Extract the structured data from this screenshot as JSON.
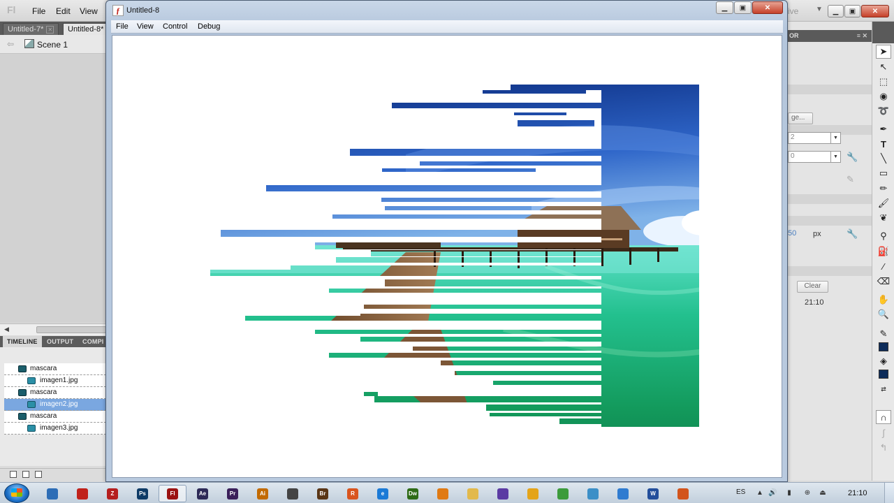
{
  "ide": {
    "logo": "Fl",
    "menus": [
      "File",
      "Edit",
      "View"
    ],
    "right_text": "ive",
    "doc_tabs": [
      "Untitled-7*",
      "Untitled-8*"
    ],
    "scene_label": "Scene 1",
    "panel_tabs": [
      "TIMELINE",
      "OUTPUT",
      "COMPI"
    ],
    "layers": [
      {
        "name": "mascara",
        "type": "mask"
      },
      {
        "name": "imagen1.jpg",
        "type": "masked"
      },
      {
        "name": "mascara",
        "type": "mask"
      },
      {
        "name": "imagen2.jpg",
        "type": "masked",
        "selected": true
      },
      {
        "name": "mascara",
        "type": "mask"
      },
      {
        "name": "imagen3.jpg",
        "type": "masked"
      }
    ],
    "properties": {
      "header": "OR",
      "button_partial": "ge...",
      "select1": "2",
      "select2": "0",
      "unit_value": "50",
      "unit": "px",
      "clear_label": "Clear",
      "time": "21:10"
    },
    "accent_color": "#0d2c5a"
  },
  "player": {
    "title": "Untitled-8",
    "menus": [
      "File",
      "View",
      "Control",
      "Debug"
    ]
  },
  "taskbar": {
    "apps": [
      {
        "id": "ie-globe",
        "label": "",
        "color": "#2d6db6"
      },
      {
        "id": "acrobat",
        "label": "",
        "color": "#c0221b"
      },
      {
        "id": "filezilla",
        "label": "Z",
        "color": "#b51f1f"
      },
      {
        "id": "photoshop",
        "label": "Ps",
        "color": "#0d3a66"
      },
      {
        "id": "flash",
        "label": "Fl",
        "color": "#9b1212",
        "active": true
      },
      {
        "id": "after-effects",
        "label": "Ae",
        "color": "#2d2a57"
      },
      {
        "id": "premiere",
        "label": "Pr",
        "color": "#3a1f5a"
      },
      {
        "id": "illustrator",
        "label": "Ai",
        "color": "#c26a00"
      },
      {
        "id": "cinema",
        "label": "",
        "color": "#444"
      },
      {
        "id": "bridge",
        "label": "Br",
        "color": "#5a3616"
      },
      {
        "id": "reader",
        "label": "R",
        "color": "#d9541e"
      },
      {
        "id": "ie",
        "label": "e",
        "color": "#1b7ad6"
      },
      {
        "id": "dreamweaver",
        "label": "Dw",
        "color": "#2e6b16"
      },
      {
        "id": "firefox",
        "label": "",
        "color": "#e07a14"
      },
      {
        "id": "explorer",
        "label": "",
        "color": "#e2b94c"
      },
      {
        "id": "vlc-like",
        "label": "",
        "color": "#5b3ba3"
      },
      {
        "id": "media",
        "label": "",
        "color": "#e4a41a"
      },
      {
        "id": "chrome",
        "label": "",
        "color": "#3c9b3c"
      },
      {
        "id": "network",
        "label": "",
        "color": "#3c8fc7"
      },
      {
        "id": "itunes",
        "label": "",
        "color": "#2f7bd0"
      },
      {
        "id": "word",
        "label": "W",
        "color": "#234e9b"
      },
      {
        "id": "avast",
        "label": "",
        "color": "#d2541c"
      }
    ],
    "lang": "ES",
    "clock": "21:10"
  }
}
